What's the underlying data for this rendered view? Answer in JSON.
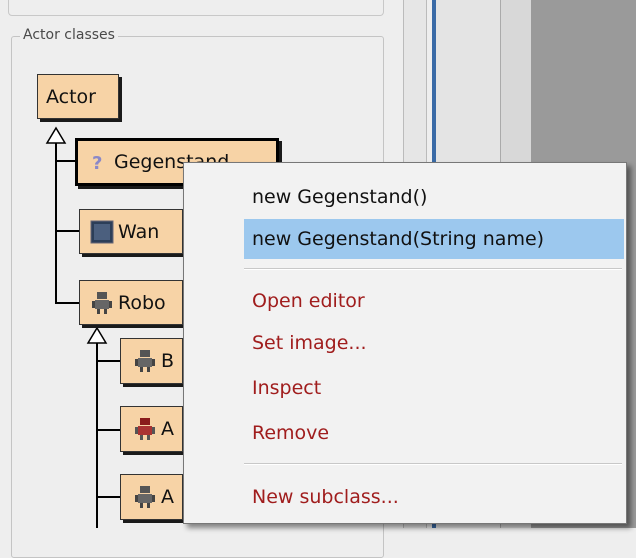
{
  "panel": {
    "legend": "Actor classes"
  },
  "classes": {
    "actor": "Actor",
    "gegenstand": "Gegenstand",
    "wand": "Wan",
    "roboter": "Robo",
    "child1": "B",
    "child2": "A",
    "child3": "A"
  },
  "menu": {
    "items": [
      {
        "label": "new Gegenstand()"
      },
      {
        "label": "new Gegenstand(String name)"
      },
      {
        "label": "Open editor"
      },
      {
        "label": "Set image..."
      },
      {
        "label": "Inspect"
      },
      {
        "label": "Remove"
      },
      {
        "label": "New subclass..."
      }
    ]
  },
  "colors": {
    "node_fill": "#f7d3a6",
    "menu_highlight": "#9cc8ee",
    "menu_red_text": "#a01d1d"
  }
}
